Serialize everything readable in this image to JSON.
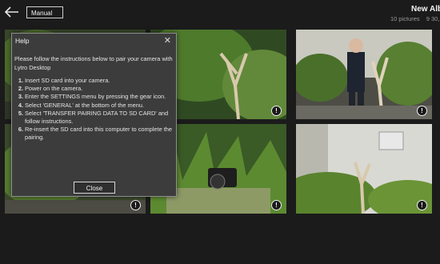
{
  "header": {
    "mode_value": "Manual",
    "album_title": "New Album",
    "picture_count": "10 pictures",
    "date": "9 30, 2015"
  },
  "photos": [
    {
      "info_icon": "info-icon",
      "info_glyph": "!"
    },
    {
      "info_icon": "info-icon",
      "info_glyph": "!"
    },
    {
      "info_icon": "info-icon",
      "info_glyph": "!"
    },
    {
      "info_icon": "info-icon",
      "info_glyph": "!"
    },
    {
      "info_icon": "info-icon",
      "info_glyph": "!"
    },
    {
      "info_icon": "info-icon",
      "info_glyph": "!"
    }
  ],
  "dialog": {
    "title": "Help",
    "close_glyph": "✕",
    "intro": "Please follow the instructions below to pair your camera with Lytro Desktop",
    "steps": [
      {
        "num": "1.",
        "text": "Insert SD card into your camera."
      },
      {
        "num": "2.",
        "text": "Power on the camera."
      },
      {
        "num": "3.",
        "text": "Enter the SETTINGS menu by pressing the gear icon."
      },
      {
        "num": "4.",
        "text": "Select 'GENERAL' at the bottom of the menu."
      },
      {
        "num": "5.",
        "text": "Select 'TRANSFER PAIRING DATA TO SD CARD' and follow instructions."
      },
      {
        "num": "6.",
        "text": "Re-insert the SD card into this computer to complete the pairing."
      }
    ],
    "close_button_label": "Close"
  },
  "colors": {
    "background": "#1b1b1b",
    "dialog_bg": "#3c3c3c",
    "foliage": "#4c6b2c",
    "text": "#e8e8e8"
  }
}
